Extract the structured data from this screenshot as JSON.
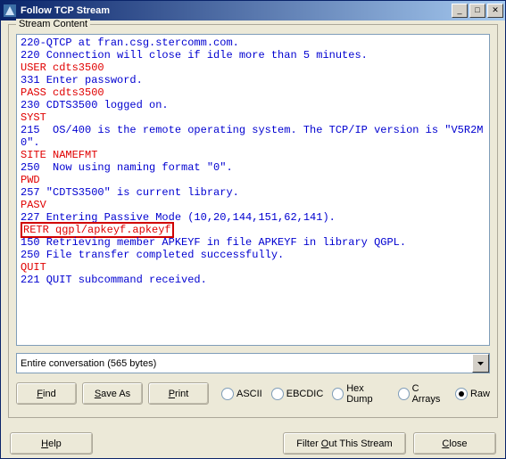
{
  "window": {
    "title": "Follow TCP Stream"
  },
  "group": {
    "label": "Stream Content"
  },
  "stream_lines": [
    {
      "cls": "blue",
      "text": "220-QTCP at fran.csg.stercomm.com."
    },
    {
      "cls": "blue",
      "text": "220 Connection will close if idle more than 5 minutes."
    },
    {
      "cls": "red",
      "text": "USER cdts3500"
    },
    {
      "cls": "blue",
      "text": "331 Enter password."
    },
    {
      "cls": "red",
      "text": "PASS cdts3500"
    },
    {
      "cls": "blue",
      "text": "230 CDTS3500 logged on."
    },
    {
      "cls": "red",
      "text": "SYST"
    },
    {
      "cls": "blue",
      "text": "215  OS/400 is the remote operating system. The TCP/IP version is \"V5R2M0\"."
    },
    {
      "cls": "red",
      "text": "SITE NAMEFMT"
    },
    {
      "cls": "blue",
      "text": "250  Now using naming format \"0\"."
    },
    {
      "cls": "red",
      "text": "PWD"
    },
    {
      "cls": "blue",
      "text": "257 \"CDTS3500\" is current library."
    },
    {
      "cls": "red",
      "text": "PASV"
    },
    {
      "cls": "blue",
      "text": "227 Entering Passive Mode (10,20,144,151,62,141)."
    },
    {
      "cls": "red",
      "text": "RETR qgpl/apkeyf.apkeyf",
      "highlight": true
    },
    {
      "cls": "blue",
      "text": "150 Retrieving member APKEYF in file APKEYF in library QGPL."
    },
    {
      "cls": "blue",
      "text": "250 File transfer completed successfully."
    },
    {
      "cls": "red",
      "text": "QUIT"
    },
    {
      "cls": "blue",
      "text": "221 QUIT subcommand received."
    }
  ],
  "combo": {
    "text": "Entire conversation (565 bytes)"
  },
  "buttons": {
    "find": "Find",
    "saveas": "Save As",
    "print": "Print",
    "help": "Help",
    "filter": "Filter Out This Stream",
    "close": "Close"
  },
  "radios": {
    "ascii": "ASCII",
    "ebcdic": "EBCDIC",
    "hex": "Hex Dump",
    "carrays": "C Arrays",
    "raw": "Raw",
    "selected": "raw"
  },
  "win_btns": {
    "min": "_",
    "max": "□",
    "close": "✕"
  }
}
